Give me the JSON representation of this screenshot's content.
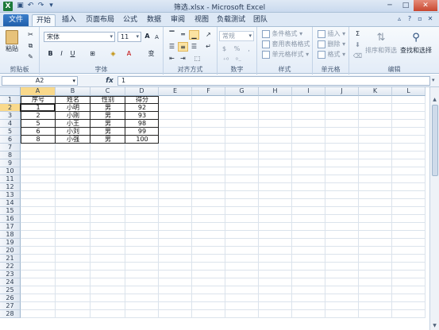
{
  "window": {
    "title": "筛选.xlsx - Microsoft Excel",
    "app_icon_letter": "X",
    "qat_icons": [
      "save-icon",
      "undo-icon",
      "redo-icon",
      "customize-icon"
    ],
    "controls": {
      "minimize": "─",
      "maximize": "□",
      "close": "✕"
    }
  },
  "ribbon_tabs": [
    {
      "label": "文件"
    },
    {
      "label": "开始"
    },
    {
      "label": "插入"
    },
    {
      "label": "页面布局"
    },
    {
      "label": "公式"
    },
    {
      "label": "数据"
    },
    {
      "label": "审阅"
    },
    {
      "label": "视图"
    },
    {
      "label": "负载测试"
    },
    {
      "label": "团队"
    }
  ],
  "ribbon": {
    "clipboard": {
      "label": "剪贴板",
      "paste": "粘贴"
    },
    "font": {
      "label": "字体",
      "name": "宋体",
      "size": "11",
      "bold": "B",
      "italic": "I",
      "underline": "U",
      "grow": "A",
      "shrink": "A",
      "wen": "变"
    },
    "alignment": {
      "label": "对齐方式"
    },
    "number": {
      "label": "数字",
      "format": "常规",
      "percent": "%",
      "comma": ","
    },
    "styles": {
      "label": "样式",
      "conditional": "条件格式",
      "table": "套用表格格式",
      "cell": "单元格样式"
    },
    "cells": {
      "label": "单元格",
      "insert": "插入",
      "delete": "删除",
      "format": "格式"
    },
    "editing": {
      "label": "编辑",
      "sort": "排序和筛选",
      "find": "查找和选择",
      "sigma": "Σ"
    }
  },
  "formula_bar": {
    "name_box": "A2",
    "fx": "fx",
    "value": "1"
  },
  "columns": [
    "A",
    "B",
    "C",
    "D",
    "E",
    "F",
    "G",
    "H",
    "I",
    "J",
    "K",
    "L"
  ],
  "rows": [
    "1",
    "2",
    "3",
    "4",
    "5",
    "6",
    "7",
    "8",
    "9",
    "10",
    "11",
    "12",
    "13",
    "14",
    "15",
    "16",
    "17",
    "18",
    "19",
    "20",
    "21",
    "22",
    "23",
    "24",
    "25",
    "26",
    "27",
    "28"
  ],
  "table": {
    "header": [
      "序号",
      "姓名",
      "性别",
      "得分"
    ],
    "data": [
      [
        "1",
        "小明",
        "男",
        "92"
      ],
      [
        "2",
        "小刚",
        "男",
        "93"
      ],
      [
        "5",
        "小王",
        "男",
        "98"
      ],
      [
        "6",
        "小刘",
        "男",
        "99"
      ],
      [
        "8",
        "小强",
        "男",
        "100"
      ]
    ]
  }
}
